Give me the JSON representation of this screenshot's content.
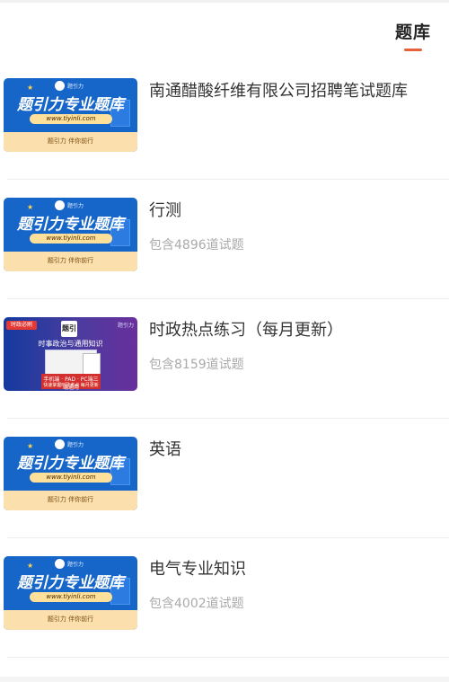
{
  "header": {
    "active_tab": "题库"
  },
  "banner": {
    "title": "题引力专业题库",
    "url": "www.tiyinli.com",
    "tagline": "题引力 伴你前行",
    "logo_text": "题引力"
  },
  "news_thumb": {
    "tag": "时政必刷",
    "logo": "题引",
    "brand": "题引力",
    "title": "时事政治与通用知识",
    "line1": "手机端 · PAD · PC端三端通用",
    "line2": "快速掌握时政考点 每月更新"
  },
  "items": [
    {
      "title": "南通醋酸纤维有限公司招聘笔试题库",
      "subtitle": ""
    },
    {
      "title": "行测",
      "subtitle": "包含4896道试题"
    },
    {
      "title": "时政热点练习（每月更新）",
      "subtitle": "包含8159道试题"
    },
    {
      "title": "英语",
      "subtitle": ""
    },
    {
      "title": "电气专业知识",
      "subtitle": "包含4002道试题"
    }
  ],
  "colors": {
    "accent": "#e8613a",
    "banner_blue": "#1566c8"
  }
}
